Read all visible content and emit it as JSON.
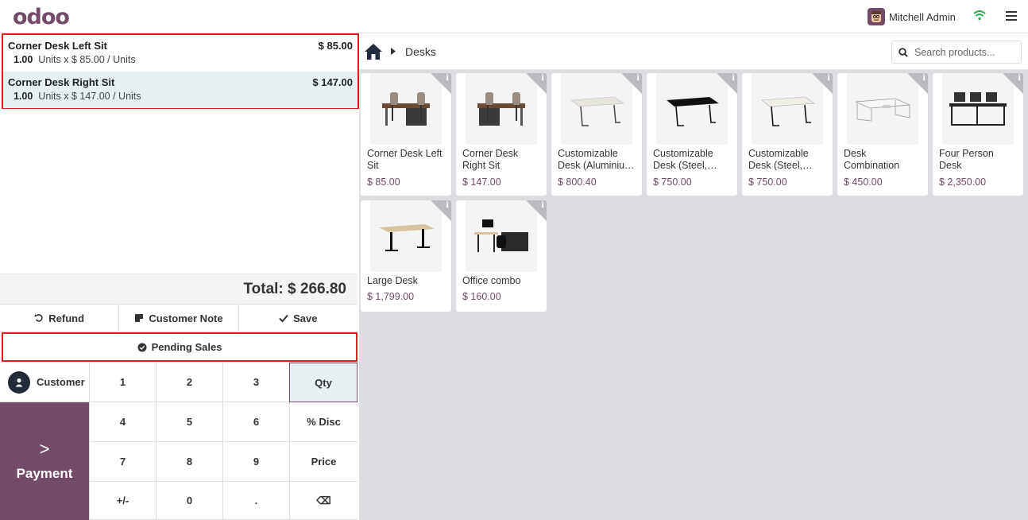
{
  "header": {
    "logo": "odoo",
    "user_name": "Mitchell Admin"
  },
  "order": {
    "lines": [
      {
        "name": "Corner Desk Left Sit",
        "price": "$ 85.00",
        "qty": "1.00",
        "unit_text": "Units x $ 85.00 / Units"
      },
      {
        "name": "Corner Desk Right Sit",
        "price": "$ 147.00",
        "qty": "1.00",
        "unit_text": "Units x $ 147.00 / Units"
      }
    ],
    "total": "Total: $ 266.80"
  },
  "actions": {
    "refund": "Refund",
    "customer_note": "Customer Note",
    "save": "Save",
    "pending_sales": "Pending Sales"
  },
  "numpad": {
    "customer": "Customer",
    "payment": "Payment",
    "keys": [
      "1",
      "2",
      "3",
      "Qty",
      "4",
      "5",
      "6",
      "% Disc",
      "7",
      "8",
      "9",
      "Price",
      "+/-",
      "0",
      ".",
      "⌫"
    ]
  },
  "breadcrumb": {
    "category": "Desks"
  },
  "search": {
    "placeholder": "Search products..."
  },
  "products": [
    {
      "name": "Corner Desk Left Sit",
      "price": "$ 85.00"
    },
    {
      "name": "Corner Desk Right Sit",
      "price": "$ 147.00"
    },
    {
      "name": "Customizable Desk (Aluminiu…",
      "price": "$ 800.40"
    },
    {
      "name": "Customizable Desk (Steel,…",
      "price": "$ 750.00"
    },
    {
      "name": "Customizable Desk (Steel,…",
      "price": "$ 750.00"
    },
    {
      "name": "Desk Combination",
      "price": "$ 450.00"
    },
    {
      "name": "Four Person Desk",
      "price": "$ 2,350.00"
    },
    {
      "name": "Large Desk",
      "price": "$ 1,799.00"
    },
    {
      "name": "Office combo",
      "price": "$ 160.00"
    }
  ],
  "colors": {
    "brand": "#714b67",
    "highlight_border": "#d81e1e",
    "selected_bg": "#e6f0f2"
  }
}
